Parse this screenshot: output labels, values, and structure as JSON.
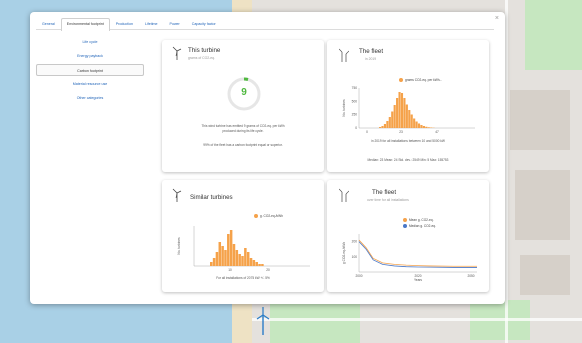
{
  "tabs": [
    "General",
    "Environmental footprint",
    "Production",
    "Lifetime",
    "Power",
    "Capacity factor"
  ],
  "active_tab_index": 1,
  "sidenav": [
    "Life cycle",
    "Energy payback",
    "Carbon footprint",
    "Material resource use",
    "Other categories"
  ],
  "active_sidenav_index": 2,
  "close_label": "×",
  "cards": {
    "this_turbine": {
      "title": "This turbine",
      "subtitle": "grams of CO2-eq.",
      "gauge_value": "9",
      "desc1": "This wind turbine has emitted 9 grams of CO2-eq. per kWh",
      "desc2": "produced during its life cycle.",
      "desc3": "99% of the fleet has a carbon footprint equal or superior."
    },
    "fleet": {
      "title": "The fleet",
      "subtitle": "in 2019",
      "legend": "grams CO2-eq. per kWh...",
      "ylabel": "No. turbines",
      "yticks": [
        "750",
        "500",
        "250",
        "0"
      ],
      "xticks": [
        "0",
        "23",
        "47"
      ],
      "caption": "in 2019 for all installations between 10 and 5000 kW",
      "stats": "Median: 23  Mean: 24  Std. dev.: 2549  Min: 5  Max: 155753"
    },
    "similar": {
      "title": "Similar turbines",
      "legend": "g. CO2-eq./kWh",
      "ylabel": "No. turbines",
      "xticks": [
        "10",
        "20"
      ],
      "caption": "For all installations of 2075 kW +/- 5%"
    },
    "fleet_time": {
      "title": "The fleet",
      "subtitle": "over time for all installations",
      "legend_mean": "Mean g. CO2-eq.",
      "legend_median": "Median g. CO2-eq.",
      "ylabel": "g CO2-eq./kWh",
      "yticks": [
        "200",
        "100"
      ],
      "xticks": [
        "2000",
        "2020",
        "2050"
      ],
      "xlabel": "Years"
    }
  },
  "colors": {
    "accent_orange": "#f5a24a",
    "mean_line": "#f5a24a",
    "median_line": "#4a78c8",
    "gauge_green": "#4fb83f",
    "link_blue": "#1f63b8"
  },
  "chart_data": [
    {
      "type": "bar",
      "title": "The fleet",
      "xlabel": "",
      "ylabel": "No. turbines",
      "x": [
        6,
        8,
        10,
        12,
        14,
        16,
        18,
        20,
        22,
        24,
        26,
        28,
        30,
        32,
        34,
        36,
        38,
        40,
        42,
        44,
        46,
        48,
        50
      ],
      "values": [
        20,
        40,
        80,
        140,
        220,
        330,
        460,
        600,
        720,
        700,
        600,
        470,
        360,
        270,
        190,
        130,
        90,
        60,
        40,
        25,
        15,
        10,
        5
      ],
      "ylim": [
        0,
        800
      ]
    },
    {
      "type": "bar",
      "title": "Similar turbines",
      "xlabel": "",
      "ylabel": "No. turbines",
      "x": [
        7,
        8,
        9,
        10,
        11,
        12,
        13,
        14,
        15,
        16,
        17,
        18,
        19,
        20,
        21,
        22,
        23,
        24,
        25
      ],
      "values": [
        2,
        4,
        7,
        12,
        10,
        8,
        16,
        18,
        11,
        8,
        6,
        5,
        9,
        7,
        4,
        3,
        2,
        1,
        1
      ],
      "ylim": [
        0,
        20
      ]
    },
    {
      "type": "line",
      "title": "The fleet",
      "xlabel": "Years",
      "ylabel": "g CO2-eq./kWh",
      "x": [
        2000,
        2003,
        2006,
        2010,
        2015,
        2020,
        2025,
        2030,
        2040,
        2050
      ],
      "series": [
        {
          "name": "Mean g. CO2-eq.",
          "values": [
            210,
            160,
            90,
            60,
            50,
            45,
            42,
            40,
            38,
            38
          ]
        },
        {
          "name": "Median g. CO2-eq.",
          "values": [
            200,
            150,
            80,
            50,
            40,
            35,
            33,
            32,
            30,
            30
          ]
        }
      ],
      "ylim": [
        0,
        250
      ]
    }
  ]
}
